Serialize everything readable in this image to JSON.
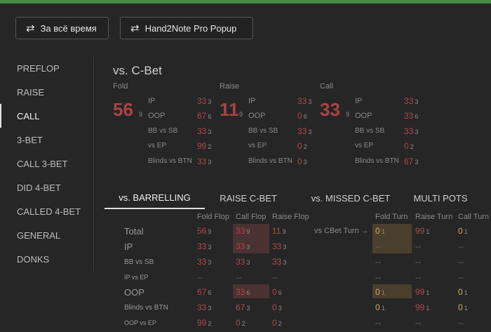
{
  "toolbar": {
    "period_label": "За всё время",
    "popup_label": "Hand2Note Pro Popup",
    "swap_icon": "swap-arrows-icon"
  },
  "sidebar": {
    "items": [
      {
        "label": "PREFLOP"
      },
      {
        "label": "RAISE"
      },
      {
        "label": "CALL",
        "active": true
      },
      {
        "label": "3-BET"
      },
      {
        "label": "CALL 3-BET"
      },
      {
        "label": "DID 4-BET"
      },
      {
        "label": "CALLED 4-BET"
      },
      {
        "label": "GENERAL"
      },
      {
        "label": "DONKS"
      }
    ]
  },
  "cbet": {
    "title": "vs. C-Bet",
    "blocks": [
      {
        "label": "Fold",
        "big": "56",
        "big_n": "9",
        "rows": [
          {
            "label": "IP",
            "v": "33",
            "n": "3"
          },
          {
            "label": "OOP",
            "v": "67",
            "n": "6"
          },
          {
            "label": "BB vs SB",
            "v": "33",
            "n": "3"
          },
          {
            "label": "vs EP",
            "v": "99",
            "n": "2"
          },
          {
            "label": "Blinds vs BTN",
            "v": "33",
            "n": "3"
          }
        ]
      },
      {
        "label": "Raise",
        "big": "11",
        "big_n": "9",
        "rows": [
          {
            "label": "IP",
            "v": "33",
            "n": "3"
          },
          {
            "label": "OOP",
            "v": "0",
            "n": "6"
          },
          {
            "label": "BB vs SB",
            "v": "33",
            "n": "3"
          },
          {
            "label": "vs EP",
            "v": "0",
            "n": "2"
          },
          {
            "label": "Blinds vs BTN",
            "v": "0",
            "n": "3"
          }
        ]
      },
      {
        "label": "Call",
        "big": "33",
        "big_n": "9",
        "rows": [
          {
            "label": "IP",
            "v": "33",
            "n": "3"
          },
          {
            "label": "OOP",
            "v": "33",
            "n": "6"
          },
          {
            "label": "BB vs SB",
            "v": "33",
            "n": "3"
          },
          {
            "label": "vs EP",
            "v": "0",
            "n": "2"
          },
          {
            "label": "Blinds vs BTN",
            "v": "67",
            "n": "3"
          }
        ]
      }
    ]
  },
  "tabs": [
    {
      "label": "vs. BARRELLING",
      "active": true
    },
    {
      "label": "RAISE C-BET"
    },
    {
      "label": "vs. MISSED C-BET"
    },
    {
      "label": "MULTI POTS"
    }
  ],
  "barrel": {
    "headers": [
      "Fold Flop",
      "Call Flop",
      "Raise Flop",
      "Fold Turn",
      "Raise Turn",
      "Call Turn"
    ],
    "annotation": "vs CBet Turn →",
    "rows": [
      {
        "label": "Total",
        "cells": [
          [
            "56",
            "9"
          ],
          [
            "33",
            "9"
          ],
          [
            "11",
            "9"
          ],
          [
            "0",
            "1"
          ],
          [
            "99",
            "1"
          ],
          [
            "0",
            "1"
          ]
        ]
      },
      {
        "label": "IP",
        "cells": [
          [
            "33",
            "3"
          ],
          [
            "33",
            "3"
          ],
          [
            "33",
            "3"
          ],
          [
            "--",
            ""
          ],
          [
            "--",
            ""
          ],
          [
            "--",
            ""
          ]
        ]
      },
      {
        "label": "BB vs SB",
        "cells": [
          [
            "33",
            "3"
          ],
          [
            "33",
            "3"
          ],
          [
            "33",
            "3"
          ],
          [
            "--",
            ""
          ],
          [
            "--",
            ""
          ],
          [
            "--",
            ""
          ]
        ]
      },
      {
        "label": "IP vs EP",
        "cells": [
          [
            "--",
            ""
          ],
          [
            "--",
            ""
          ],
          [
            "--",
            ""
          ],
          [
            "--",
            ""
          ],
          [
            "--",
            ""
          ],
          [
            "--",
            ""
          ]
        ]
      },
      {
        "label": "OOP",
        "cells": [
          [
            "67",
            "6"
          ],
          [
            "33",
            "6"
          ],
          [
            "0",
            "6"
          ],
          [
            "0",
            "1"
          ],
          [
            "99",
            "1"
          ],
          [
            "0",
            "1"
          ]
        ]
      },
      {
        "label": "Blinds vs BTN",
        "cells": [
          [
            "33",
            "3"
          ],
          [
            "67",
            "3"
          ],
          [
            "0",
            "3"
          ],
          [
            "0",
            "1"
          ],
          [
            "99",
            "1"
          ],
          [
            "0",
            "1"
          ]
        ]
      },
      {
        "label": "OOP vs EP",
        "cells": [
          [
            "99",
            "2"
          ],
          [
            "0",
            "2"
          ],
          [
            "0",
            "2"
          ],
          [
            "--",
            ""
          ],
          [
            "--",
            ""
          ],
          [
            "--",
            ""
          ]
        ]
      }
    ]
  }
}
